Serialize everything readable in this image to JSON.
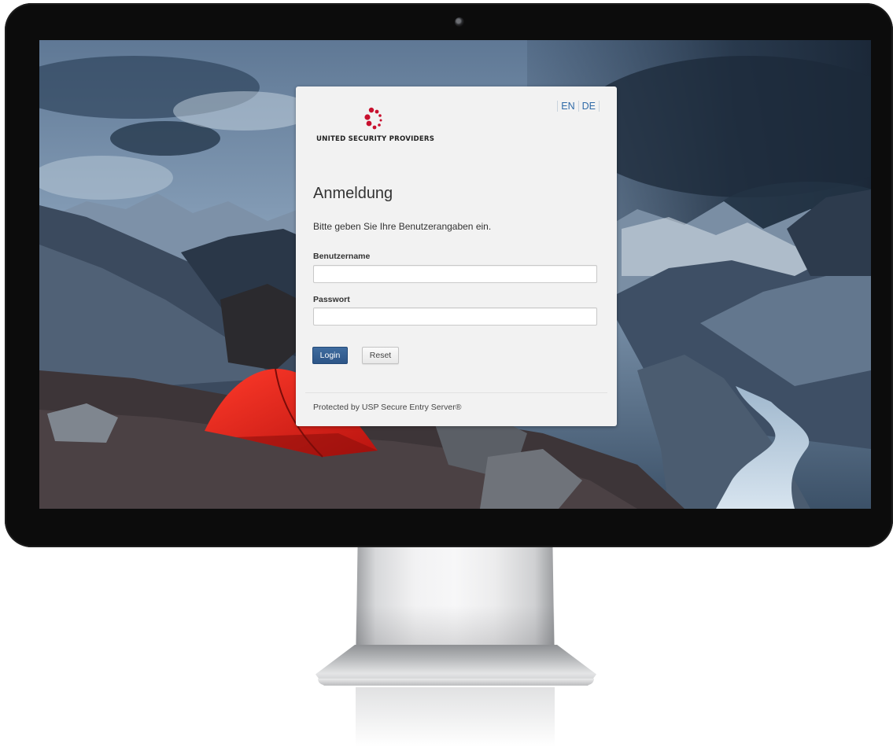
{
  "language_switch": {
    "en": "EN",
    "de": "DE"
  },
  "logo": {
    "text": "UNITED SECURITY PROVIDERS",
    "icon": "usp-dots-icon",
    "color": "#c8102e"
  },
  "login": {
    "title": "Anmeldung",
    "subtitle": "Bitte geben Sie Ihre Benutzerangaben ein.",
    "username_label": "Benutzername",
    "username_value": "",
    "password_label": "Passwort",
    "password_value": "",
    "login_button": "Login",
    "reset_button": "Reset"
  },
  "footer": {
    "text": "Protected by USP Secure Entry Server®"
  },
  "colors": {
    "primary_button": "#2d5587",
    "link": "#2f6aa8",
    "card_bg": "#f2f2f2",
    "tent": "#d8211d"
  }
}
